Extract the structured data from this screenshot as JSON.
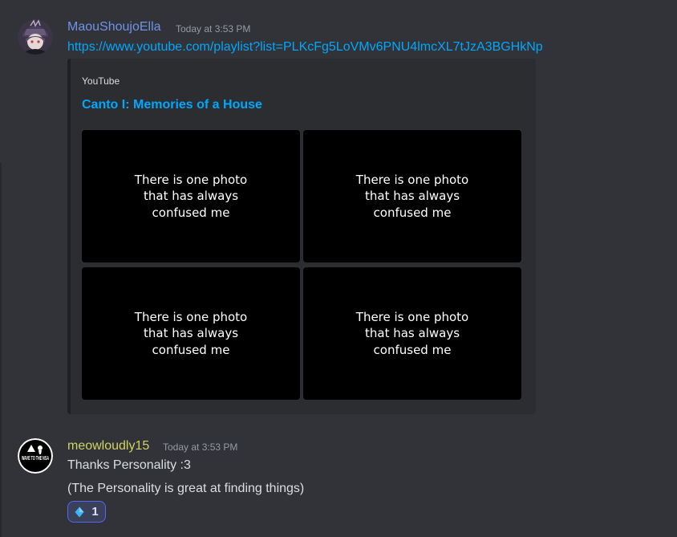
{
  "message1": {
    "username": "MaouShoujoElla",
    "username_color": "#6f93e8",
    "timestamp": "Today at 3:53 PM",
    "link": "https://www.youtube.com/playlist?list=PLKcFg5LoVMv6PNU4lmcXL7tJzA3BGHkNp",
    "embed": {
      "provider": "YouTube",
      "title": "Canto I: Memories of a House",
      "thumbnails": [
        "There is one photo that has always confused me",
        "There is one photo that has always confused me",
        "There is one photo that has always confused me",
        "There is one photo that has always confused me"
      ]
    }
  },
  "message2": {
    "username": "meowloudly15",
    "username_color": "#d1d365",
    "timestamp": "Today at 3:53 PM",
    "lines": [
      "Thanks Personality :3",
      "(The Personality is great at finding things)"
    ],
    "avatar_text": "WAVE TO THE NSA",
    "reaction": {
      "icon": "diamond-icon",
      "count": "1"
    }
  }
}
